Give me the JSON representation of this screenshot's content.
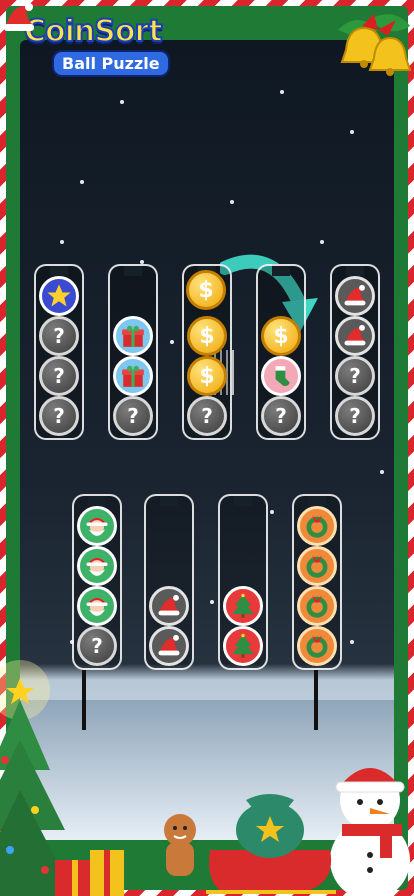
{
  "game": {
    "title": "CoinSort",
    "subtitle": "Ball Puzzle",
    "unknown_symbol": "?",
    "coin_symbol": "$"
  },
  "colors": {
    "frame_red": "#d9262c",
    "frame_green": "#1f7a35",
    "gold": "#f0a90c",
    "hint_arrow": "#3fd6c4"
  },
  "tubes_top": [
    {
      "coins": [
        "star",
        "unknown",
        "unknown",
        "unknown"
      ]
    },
    {
      "coins": [
        "gift",
        "gift",
        "unknown"
      ]
    },
    {
      "coins": [
        "gold",
        "gold",
        "unknown"
      ]
    },
    {
      "coins": [
        "gold",
        "stocking",
        "unknown"
      ]
    },
    {
      "coins": [
        "hat",
        "hat",
        "unknown",
        "unknown"
      ]
    }
  ],
  "tubes_bottom": [
    {
      "coins": [
        "santa",
        "santa",
        "santa",
        "unknown"
      ]
    },
    {
      "coins": [
        "hat",
        "hat"
      ]
    },
    {
      "coins": [
        "tree",
        "tree"
      ]
    },
    {
      "coins": [
        "wreath",
        "wreath",
        "wreath",
        "wreath"
      ]
    }
  ],
  "icons": {
    "hint": "curved-arrow-icon",
    "bells": "christmas-bells-icon",
    "hat": "santa-hat-icon",
    "tree": "christmas-tree-icon",
    "snowman": "snowman-icon",
    "sleigh": "sleigh-icon"
  }
}
